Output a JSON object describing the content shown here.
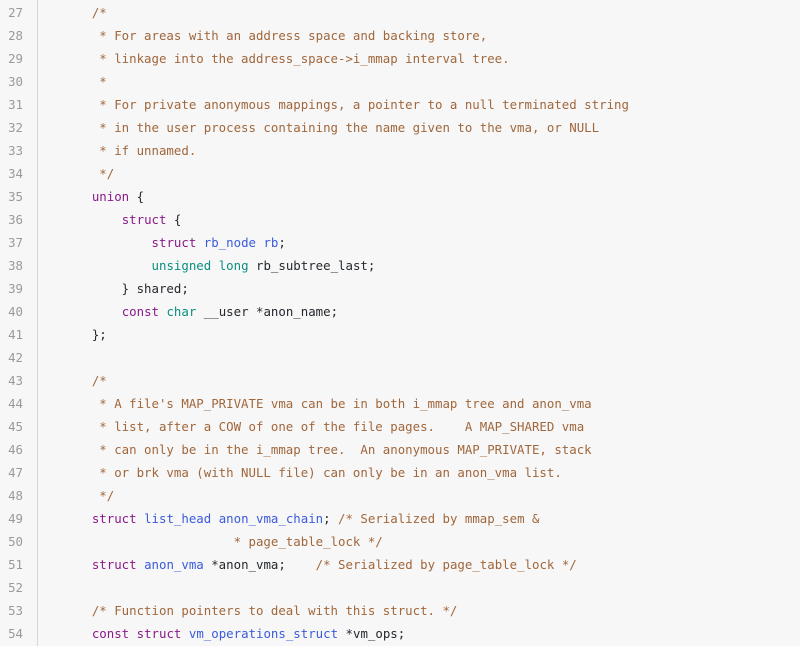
{
  "viewer": {
    "title": "Source code viewer",
    "language": "C",
    "theme_background": "#f7f7f7",
    "gutter_rule_color": "#d6d6d6",
    "first_line_number": 27,
    "last_line_number": 54,
    "colors": {
      "text": "#24292e",
      "line_number": "#9a9a9a",
      "comment": "#a0673c",
      "keyword": "#8b1a8b",
      "type": "#0a8f80",
      "identifier": "#3b5bdb"
    }
  },
  "lines": [
    {
      "num": "27",
      "tokens": [
        {
          "t": "    ",
          "c": "plain"
        },
        {
          "t": "/*",
          "c": "comment"
        }
      ]
    },
    {
      "num": "28",
      "tokens": [
        {
          "t": "     * For areas with an address space and backing store,",
          "c": "comment"
        }
      ]
    },
    {
      "num": "29",
      "tokens": [
        {
          "t": "     * linkage into the address_space->i_mmap interval tree.",
          "c": "comment"
        }
      ]
    },
    {
      "num": "30",
      "tokens": [
        {
          "t": "     *",
          "c": "comment"
        }
      ]
    },
    {
      "num": "31",
      "tokens": [
        {
          "t": "     * For private anonymous mappings, a pointer to a null terminated string",
          "c": "comment"
        }
      ]
    },
    {
      "num": "32",
      "tokens": [
        {
          "t": "     * in the user process containing the name given to the vma, or NULL",
          "c": "comment"
        }
      ]
    },
    {
      "num": "33",
      "tokens": [
        {
          "t": "     * if unnamed.",
          "c": "comment"
        }
      ]
    },
    {
      "num": "34",
      "tokens": [
        {
          "t": "     */",
          "c": "comment"
        }
      ]
    },
    {
      "num": "35",
      "tokens": [
        {
          "t": "    ",
          "c": "plain"
        },
        {
          "t": "union",
          "c": "keyword"
        },
        {
          "t": " {",
          "c": "punct"
        }
      ]
    },
    {
      "num": "36",
      "tokens": [
        {
          "t": "        ",
          "c": "plain"
        },
        {
          "t": "struct",
          "c": "keyword"
        },
        {
          "t": " {",
          "c": "punct"
        }
      ]
    },
    {
      "num": "37",
      "tokens": [
        {
          "t": "            ",
          "c": "plain"
        },
        {
          "t": "struct",
          "c": "keyword"
        },
        {
          "t": " ",
          "c": "plain"
        },
        {
          "t": "rb_node",
          "c": "ident"
        },
        {
          "t": " ",
          "c": "plain"
        },
        {
          "t": "rb",
          "c": "ident"
        },
        {
          "t": ";",
          "c": "punct"
        }
      ]
    },
    {
      "num": "38",
      "tokens": [
        {
          "t": "            ",
          "c": "plain"
        },
        {
          "t": "unsigned",
          "c": "type"
        },
        {
          "t": " ",
          "c": "plain"
        },
        {
          "t": "long",
          "c": "type"
        },
        {
          "t": " rb_subtree_last;",
          "c": "plain"
        }
      ]
    },
    {
      "num": "39",
      "tokens": [
        {
          "t": "        } shared;",
          "c": "plain"
        }
      ]
    },
    {
      "num": "40",
      "tokens": [
        {
          "t": "        ",
          "c": "plain"
        },
        {
          "t": "const",
          "c": "keyword"
        },
        {
          "t": " ",
          "c": "plain"
        },
        {
          "t": "char",
          "c": "type"
        },
        {
          "t": " __user *anon_name;",
          "c": "plain"
        }
      ]
    },
    {
      "num": "41",
      "tokens": [
        {
          "t": "    };",
          "c": "plain"
        }
      ]
    },
    {
      "num": "42",
      "tokens": [
        {
          "t": "",
          "c": "plain"
        }
      ]
    },
    {
      "num": "43",
      "tokens": [
        {
          "t": "    ",
          "c": "plain"
        },
        {
          "t": "/*",
          "c": "comment"
        }
      ]
    },
    {
      "num": "44",
      "tokens": [
        {
          "t": "     * A file's MAP_PRIVATE vma can be in both i_mmap tree and anon_vma",
          "c": "comment"
        }
      ]
    },
    {
      "num": "45",
      "tokens": [
        {
          "t": "     * list, after a COW of one of the file pages.    A MAP_SHARED vma",
          "c": "comment"
        }
      ]
    },
    {
      "num": "46",
      "tokens": [
        {
          "t": "     * can only be in the i_mmap tree.  An anonymous MAP_PRIVATE, stack",
          "c": "comment"
        }
      ]
    },
    {
      "num": "47",
      "tokens": [
        {
          "t": "     * or brk vma (with NULL file) can only be in an anon_vma list.",
          "c": "comment"
        }
      ]
    },
    {
      "num": "48",
      "tokens": [
        {
          "t": "     */",
          "c": "comment"
        }
      ]
    },
    {
      "num": "49",
      "tokens": [
        {
          "t": "    ",
          "c": "plain"
        },
        {
          "t": "struct",
          "c": "keyword"
        },
        {
          "t": " ",
          "c": "plain"
        },
        {
          "t": "list_head",
          "c": "ident"
        },
        {
          "t": " ",
          "c": "plain"
        },
        {
          "t": "anon_vma_chain",
          "c": "ident"
        },
        {
          "t": "; ",
          "c": "punct"
        },
        {
          "t": "/* Serialized by mmap_sem &",
          "c": "comment"
        }
      ]
    },
    {
      "num": "50",
      "tokens": [
        {
          "t": "                       * page_table_lock */",
          "c": "comment"
        }
      ]
    },
    {
      "num": "51",
      "tokens": [
        {
          "t": "    ",
          "c": "plain"
        },
        {
          "t": "struct",
          "c": "keyword"
        },
        {
          "t": " ",
          "c": "plain"
        },
        {
          "t": "anon_vma",
          "c": "ident"
        },
        {
          "t": " *anon_vma;",
          "c": "plain"
        },
        {
          "t": "    ",
          "c": "plain"
        },
        {
          "t": "/* Serialized by page_table_lock */",
          "c": "comment"
        }
      ]
    },
    {
      "num": "52",
      "tokens": [
        {
          "t": "",
          "c": "plain"
        }
      ]
    },
    {
      "num": "53",
      "tokens": [
        {
          "t": "    ",
          "c": "plain"
        },
        {
          "t": "/* Function pointers to deal with this struct. */",
          "c": "comment"
        }
      ]
    },
    {
      "num": "54",
      "tokens": [
        {
          "t": "    ",
          "c": "plain"
        },
        {
          "t": "const",
          "c": "keyword"
        },
        {
          "t": " ",
          "c": "plain"
        },
        {
          "t": "struct",
          "c": "keyword"
        },
        {
          "t": " ",
          "c": "plain"
        },
        {
          "t": "vm_operations_struct",
          "c": "ident"
        },
        {
          "t": " *vm_ops;",
          "c": "plain"
        }
      ]
    }
  ]
}
